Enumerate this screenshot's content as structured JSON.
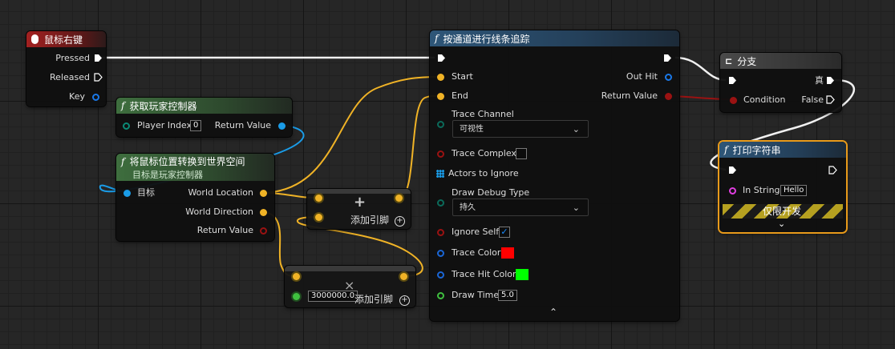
{
  "mouse_event": {
    "title": "鼠标右键",
    "pressed": "Pressed",
    "released": "Released",
    "key": "Key"
  },
  "get_controller": {
    "title": "获取玩家控制器",
    "player_index_label": "Player Index",
    "player_index_value": "0",
    "return_value": "Return Value"
  },
  "deproject": {
    "title": "将鼠标位置转换到世界空间",
    "subtitle": "目标是玩家控制器",
    "target": "目标",
    "world_location": "World Location",
    "world_direction": "World Direction",
    "return_value": "Return Value"
  },
  "add_node": {
    "symbol": "+",
    "add_pin": "添加引脚"
  },
  "multiply_node": {
    "symbol": "×",
    "value": "3000000.0",
    "add_pin": "添加引脚"
  },
  "trace": {
    "title": "按通道进行线条追踪",
    "start": "Start",
    "end": "End",
    "out_hit": "Out Hit",
    "return_value": "Return Value",
    "trace_channel": "Trace Channel",
    "trace_channel_value": "可视性",
    "trace_complex": "Trace Complex",
    "actors_to_ignore": "Actors to Ignore",
    "draw_debug_type": "Draw Debug Type",
    "draw_debug_value": "持久",
    "ignore_self": "Ignore Self",
    "trace_color": "Trace Color",
    "trace_hit_color": "Trace Hit Color",
    "draw_time": "Draw Time",
    "draw_time_value": "5.0",
    "trace_color_hex": "#ff0000",
    "trace_hit_color_hex": "#00ff00"
  },
  "branch": {
    "title": "分支",
    "condition": "Condition",
    "true_label": "真",
    "false_label": "False"
  },
  "print": {
    "title": "打印字符串",
    "in_string": "In String",
    "in_string_value": "Hello",
    "dev_only": "仅限开发"
  },
  "colors": {
    "exec": "#ffffff",
    "vector": "#f0b326",
    "object": "#1a9ce8",
    "bool": "#9a1212",
    "struct": "#0a66d6",
    "float": "#3fbf3f",
    "string": "#e13ee0",
    "byte": "#0b8a76",
    "linear_color": "#0a66d6"
  }
}
